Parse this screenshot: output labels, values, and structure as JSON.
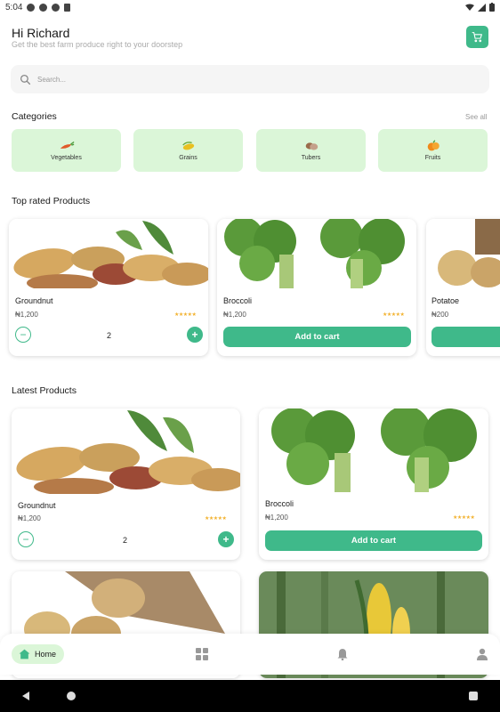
{
  "status_bar": {
    "time": "5:04"
  },
  "header": {
    "greeting": "Hi Richard",
    "subtitle": "Get the best farm produce right to your doorstep",
    "cart_icon": "cart-icon"
  },
  "search": {
    "placeholder": "Search..."
  },
  "categories": {
    "title": "Categories",
    "see_all": "See all",
    "items": [
      {
        "label": "Vegetables",
        "icon": "vegetables-icon"
      },
      {
        "label": "Grains",
        "icon": "grains-icon"
      },
      {
        "label": "Tubers",
        "icon": "tubers-icon"
      },
      {
        "label": "Fruits",
        "icon": "fruits-icon"
      }
    ]
  },
  "top_rated": {
    "title": "Top rated Products",
    "items": [
      {
        "name": "Groundnut",
        "price": "₦1,200",
        "rating": "★★★★★",
        "quantity": "2"
      },
      {
        "name": "Broccoli",
        "price": "₦1,200",
        "rating": "★★★★★",
        "button": "Add to cart"
      },
      {
        "name": "Potatoe",
        "price": "₦200"
      }
    ]
  },
  "latest": {
    "title": "Latest Products",
    "items": [
      {
        "name": "Groundnut",
        "price": "₦1,200",
        "rating": "★★★★★",
        "quantity": "2"
      },
      {
        "name": "Broccoli",
        "price": "₦1,200",
        "rating": "★★★★★",
        "button": "Add to cart"
      }
    ]
  },
  "bottom_nav": {
    "home_label": "Home",
    "items": [
      "home-icon",
      "grid-icon",
      "bell-icon",
      "profile-icon"
    ]
  },
  "colors": {
    "accent": "#3fb98a",
    "category_bg": "#dbf6d8",
    "star": "#f2b230"
  }
}
